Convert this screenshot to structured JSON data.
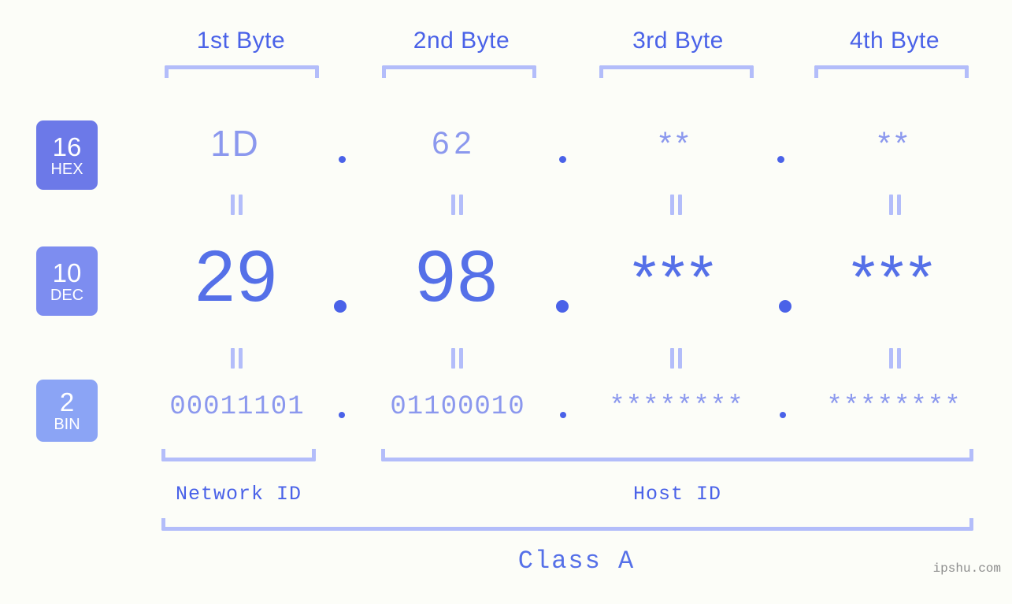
{
  "background_color": "#fcfdf8",
  "colors": {
    "badge_hex": "#6c79e8",
    "badge_dec": "#7d8df0",
    "badge_bin": "#8ba4f5",
    "accent_strong": "#4a62e8",
    "accent_light": "#8b98ee",
    "bracket": "#b3bdfa",
    "dec_digits": "#5570e8",
    "watermark": "#8c8c8c"
  },
  "byte_headers": [
    {
      "label": "1st Byte"
    },
    {
      "label": "2nd Byte"
    },
    {
      "label": "3rd Byte"
    },
    {
      "label": "4th Byte"
    }
  ],
  "rows": [
    {
      "base_number": "16",
      "base_name": "HEX",
      "values": [
        "1D",
        "62",
        "**",
        "**"
      ],
      "separator": "."
    },
    {
      "base_number": "10",
      "base_name": "DEC",
      "values": [
        "29",
        "98",
        "***",
        "***"
      ],
      "separator": "."
    },
    {
      "base_number": "2",
      "base_name": "BIN",
      "values": [
        "00011101",
        "01100010",
        "********",
        "********"
      ],
      "separator": "."
    }
  ],
  "equality_marks": {
    "glyph": "||",
    "count_per_row": 4,
    "rows": 2
  },
  "segments": {
    "network_id_label": "Network ID",
    "host_id_label": "Host ID"
  },
  "class_label": "Class A",
  "watermark": "ipshu.com"
}
